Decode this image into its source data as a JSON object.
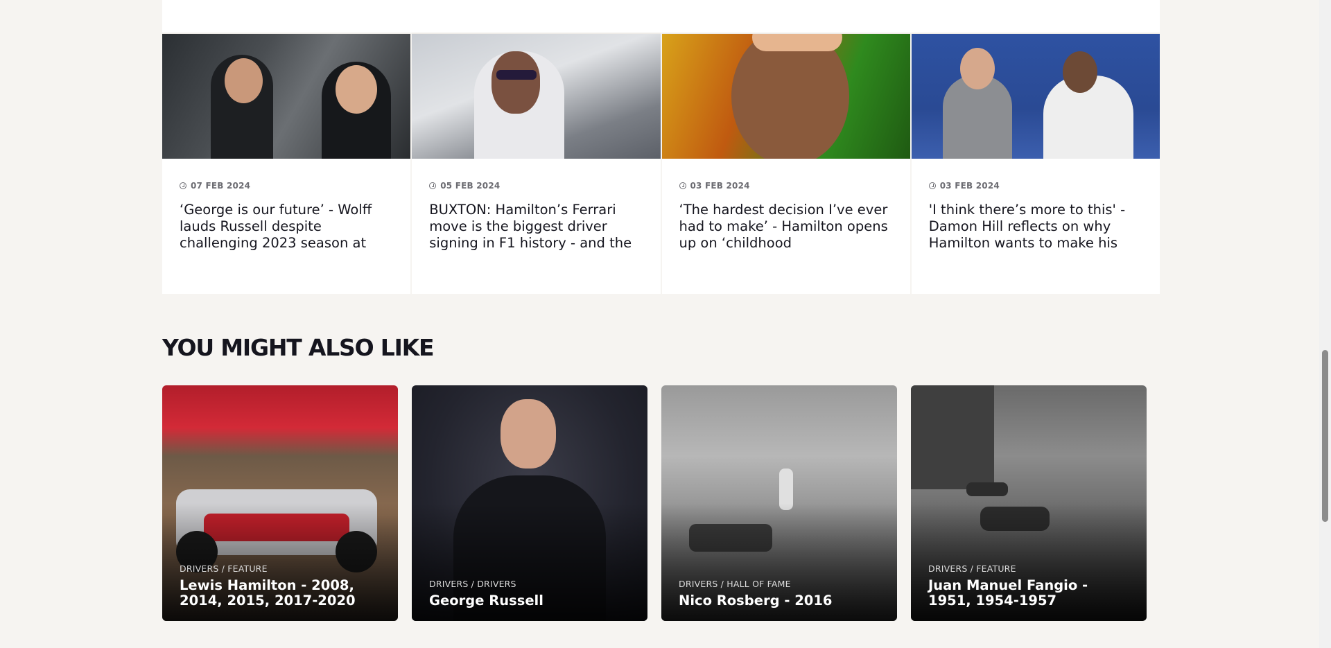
{
  "news": [
    {
      "date": "07 FEB 2024",
      "title": "‘George is our future’ - Wolff lauds Russell despite challenging 2023 season at"
    },
    {
      "date": "05 FEB 2024",
      "title": "BUXTON: Hamilton’s Ferrari move is the biggest driver signing in F1 history - and the"
    },
    {
      "date": "03 FEB 2024",
      "title": "‘The hardest decision I’ve ever had to make’ - Hamilton opens up on ‘childhood"
    },
    {
      "date": "03 FEB 2024",
      "title": "'I think there’s more to this' - Damon Hill reflects on why Hamilton wants to make his"
    }
  ],
  "section": {
    "title": "YOU MIGHT ALSO LIKE"
  },
  "related": [
    {
      "category": "DRIVERS / FEATURE",
      "title": "Lewis Hamilton - 2008, 2014, 2015, 2017-2020"
    },
    {
      "category": "DRIVERS / DRIVERS",
      "title": "George Russell"
    },
    {
      "category": "DRIVERS / HALL OF FAME",
      "title": "Nico Rosberg - 2016"
    },
    {
      "category": "DRIVERS / FEATURE",
      "title": "Juan Manuel Fangio - 1951, 1954-1957"
    }
  ],
  "icons": {
    "date": "clock-icon"
  },
  "colors": {
    "background": "#f6f4f1",
    "text": "#15151e",
    "muted": "#6c6c72"
  }
}
